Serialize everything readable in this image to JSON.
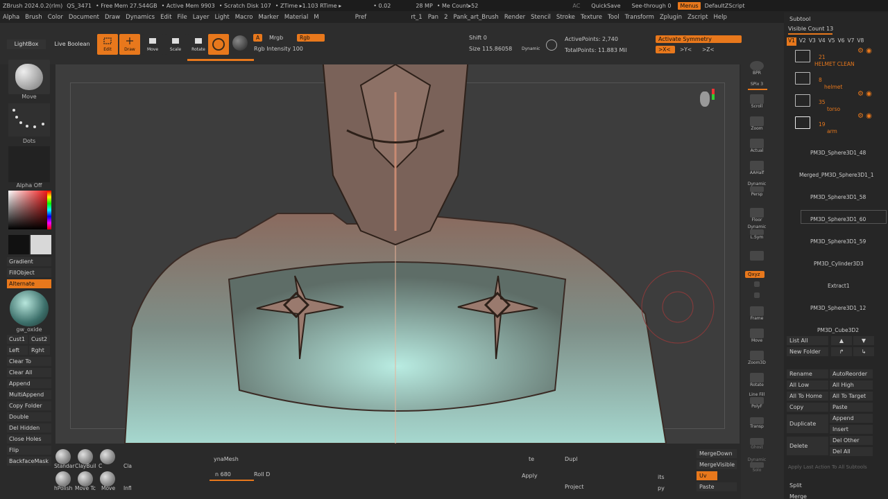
{
  "titlebar": {
    "app": "ZBrush 2024.0.2(rlm)",
    "doc": "QS_3471",
    "free_mem": "• Free Mem 27.544GB",
    "active_mem": "• Active Mem 9903",
    "scratch": "• Scratch Disk 107",
    "ztime": "• ZTime ▸1.103 RTime ▸",
    "timer": "• 0.02",
    "mp": "28 MP",
    "mesh": "• Me  Count▸52",
    "ac": "AC",
    "quicksave": "QuickSave",
    "see_through": "See-through  0",
    "menus": "Menus",
    "defaultzscript": "DefaultZScript"
  },
  "menubar": {
    "items": [
      "Alpha",
      "Brush",
      "Color",
      "Document",
      "Draw",
      "Dynamics",
      "Edit",
      "File",
      "Layer",
      "Light",
      "Macro",
      "Marker",
      "Material",
      "M",
      "Pref",
      "rt_1",
      "Pan",
      "2",
      "Pank_art_Brush",
      "Render",
      "Stencil",
      "Stroke",
      "Texture",
      "Tool",
      "Transform",
      "Zplugin",
      "Zscript",
      "Help"
    ]
  },
  "toolbar": {
    "lightbox": "LightBox",
    "live_boolean": "Live Boolean",
    "edit": "Edit",
    "draw": "Draw",
    "move": "Move",
    "scale": "Scale",
    "rotate": "Rotate",
    "a_btn": "A",
    "mrgb": "Mrgb",
    "rgb": "Rgb",
    "rgb_intensity": "Rgb Intensity 100",
    "z_shift": "Shift 0",
    "draw_size": "Size 115.86058",
    "dynamic": "Dynamic",
    "active_points": "ActivePoints: 2,740",
    "total_points": "TotalPoints: 11.883 Mil",
    "activate_symmetry": "Activate Symmetry",
    "sym_x": ">X<",
    "sym_y": ">Y<",
    "sym_z": ">Z<"
  },
  "leftshelf": {
    "brush_label": "Move",
    "stroke_label": "Dots",
    "alpha_label": "Alpha Off",
    "gradient": "Gradient",
    "fillobject": "FillObject",
    "alternate": "Alternate",
    "material_label": "gw_oxide",
    "cust1": "Cust1",
    "cust2": "Cust2",
    "left": "Left",
    "right": "Rght",
    "clear_to": "Clear To",
    "clear_all": "Clear All",
    "append": "Append",
    "multiappend": "MultiAppend",
    "copy_folder": "Copy Folder",
    "double": "Double",
    "del_hidden": "Del Hidden",
    "close_holes": "Close Holes",
    "flip": "Flip",
    "backfacemask": "BackfaceMask"
  },
  "rightnav": {
    "bpr": "BPR",
    "spix": "SPix 3",
    "scroll": "Scroll",
    "zoom": "Zoom",
    "actual": "Actual",
    "aahalf": "AAHalf",
    "dynamic_persp": "Dynamic",
    "persp": "Persp",
    "floor": "Floor",
    "dynamic2": "Dynamic",
    "lsym": "L.Sym",
    "xyz": "Qxyz",
    "frame": "Frame",
    "move": "Move",
    "zoom3d": "Zoom3D",
    "rotate": "Rotate",
    "line_fill": "Line Fill",
    "polyf": "PolyF",
    "transp": "Transp",
    "ghost": "Ghost",
    "dynamic3": "Dynamic",
    "solo": "Solo"
  },
  "subtool": {
    "title": "Subtool",
    "visible_count": "Visible Count 13",
    "versions": [
      "V1",
      "V2",
      "V3",
      "V4",
      "V5",
      "V6",
      "V7",
      "V8"
    ],
    "folders": [
      {
        "num": "21",
        "name": "HELMET CLEAN"
      },
      {
        "num": "8",
        "name": "helmet"
      },
      {
        "num": "35",
        "name": "torso"
      },
      {
        "num": "19",
        "name": "arm"
      }
    ],
    "items": [
      "PM3D_Sphere3D1_48",
      "Merged_PM3D_Sphere3D1_1",
      "PM3D_Sphere3D1_58",
      "PM3D_Sphere3D1_60",
      "PM3D_Sphere3D1_59",
      "PM3D_Cylinder3D3",
      "Extract1",
      "PM3D_Sphere3D1_12",
      "PM3D_Cube3D2"
    ],
    "list_all": "List All",
    "new_folder": "New Folder",
    "rename": "Rename",
    "autoreorder": "AutoReorder",
    "all_low": "All Low",
    "all_high": "All High",
    "all_to_home": "All To Home",
    "all_to_target": "All To Target",
    "copy": "Copy",
    "paste": "Paste",
    "duplicate": "Duplicate",
    "append": "Append",
    "insert": "Insert",
    "delete": "Delete",
    "del_other": "Del Other",
    "del_all": "Del All",
    "apply_last": "Apply Last Action To All Subtools",
    "split": "Split",
    "merge": "Merge"
  },
  "bottomshelf": {
    "brushes": [
      "Standar",
      "ClayBuil",
      "C",
      "Cla",
      "hPolish",
      "Move Tc",
      "Move",
      "Infl"
    ],
    "dynamesh": "ynaMesh",
    "res": "n 680",
    "roll": "Roll D",
    "dupl": "Dupl",
    "apply": "Apply",
    "project": "Project",
    "te": "te",
    "its": "its",
    "py": "py",
    "mergedown": "MergeDown",
    "mergevisible": "MergeVisible",
    "uv": "Uv",
    "paste": "Paste"
  },
  "colors": {
    "accent": "#e8781c",
    "panel": "#2a2a2a",
    "canvas": "#3d3d3d"
  }
}
